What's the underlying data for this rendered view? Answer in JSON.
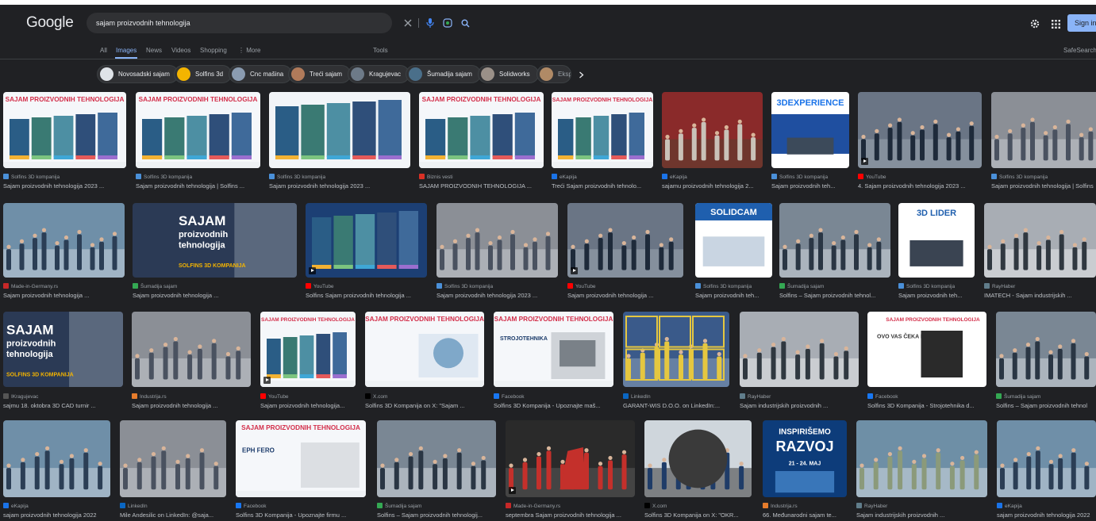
{
  "header": {
    "logo": "Google",
    "search_value": "sajam proizvodnih tehnologija",
    "signin_label": "Sign in"
  },
  "nav": {
    "tabs": [
      "All",
      "Images",
      "News",
      "Videos",
      "Shopping",
      "⋮ More"
    ],
    "tools": "Tools",
    "safesearch": "SafeSearch"
  },
  "chips": [
    "Novosadski sajam",
    "Solfins 3d",
    "Cnc mašina",
    "Treći sajam",
    "Kragujevac",
    "Šumadija sajam",
    "Solidworks",
    "Ekspo"
  ],
  "overlays": {
    "spt": "SAJAM PROIZVODNIH TEHNOLOGIJA",
    "sajam": "SAJAM",
    "proizvodnih": "proizvodnih",
    "tehnologija": "tehnologija",
    "solfins": "SOLFINS 3D KOMPANIJA",
    "exp": "3DEXPERIENCE",
    "solidcam": "SOLIDCAM",
    "lider": "3D LIDER",
    "inspirisemo": "INSPIRIŠEMO",
    "razvoj": "RAZVOJ",
    "maj": "21 - 24. MAJ",
    "ovo": "OVO VAS ČEKA NA SAJMU!",
    "eph": "EPH FERO",
    "strojotehnika": "STROJOTEHNIKA"
  },
  "results": [
    [
      {
        "source": "Solfins 3D kompanija",
        "title": "Sajam proizvodnih tehnologija 2023 ..."
      },
      {
        "source": "Solfins 3D kompanija",
        "title": "Sajam proizvodnih tehnologija | Solfins ..."
      },
      {
        "source": "Solfins 3D kompanija",
        "title": "Sajam proizvodnih tehnologija 2023 ..."
      },
      {
        "source": "Biznis vesti",
        "title": "SAJAM PROIZVODNIH TEHNOLOGIJA ..."
      },
      {
        "source": "eKapija",
        "title": "Treći Sajam proizvodnih tehnolo..."
      },
      {
        "source": "eKapija",
        "title": "sajamu proizvodnih tehnologija 2..."
      },
      {
        "source": "Solfins 3D kompanija",
        "title": "Sajam proizvodnih teh..."
      },
      {
        "source": "YouTube",
        "title": "4. Sajam proizvodnih tehnologija 2023 ..."
      },
      {
        "source": "Solfins 3D kompanija",
        "title": "Sajam proizvodnih tehnologija | Solfins"
      }
    ],
    [
      {
        "source": "Made-in-Germany.rs",
        "title": "Sajam proizvodnih tehnologija ..."
      },
      {
        "source": "Šumadija sajam",
        "title": "Sajam proizvodnih tehnologija ..."
      },
      {
        "source": "YouTube",
        "title": "Solfins Sajam proizvodnih tehnologija ..."
      },
      {
        "source": "Solfins 3D kompanija",
        "title": "Sajam proizvodnih tehnologija 2023 ..."
      },
      {
        "source": "YouTube",
        "title": "Sajam proizvodnih tehnologija ..."
      },
      {
        "source": "Solfins 3D kompanija",
        "title": "Sajam proizvodnih teh..."
      },
      {
        "source": "Šumadija sajam",
        "title": "Solfins – Sajam proizvodnih tehnol..."
      },
      {
        "source": "Solfins 3D kompanija",
        "title": "Sajam proizvodnih teh..."
      },
      {
        "source": "RayHaber",
        "title": "IMATECH - Sajam industrijskih ..."
      }
    ],
    [
      {
        "source": "IKragujevac",
        "title": "sajmu 18. oktobra 3D CAD turnir ..."
      },
      {
        "source": "Industrija.rs",
        "title": "Sajam proizvodnih tehnologija ..."
      },
      {
        "source": "YouTube",
        "title": "Sajam proizvodnih tehnologija..."
      },
      {
        "source": "X.com",
        "title": "Solfins 3D Kompanija on X: \"Sajam ..."
      },
      {
        "source": "Facebook",
        "title": "Solfins 3D Kompanija - Upoznajte maš..."
      },
      {
        "source": "LinkedIn",
        "title": "GARANT-WIS D.O.O. on LinkedIn:..."
      },
      {
        "source": "RayHaber",
        "title": "Sajam industrijskih proizvodnih ..."
      },
      {
        "source": "Facebook",
        "title": "Solfins 3D Kompanija - Strojotehnika d..."
      },
      {
        "source": "Šumadija sajam",
        "title": "Solfins – Sajam proizvodnih tehnol"
      }
    ],
    [
      {
        "source": "eKapija",
        "title": "sajam proizvodnih tehnologija 2022"
      },
      {
        "source": "LinkedIn",
        "title": "Mile Andesilic on LinkedIn: @saja..."
      },
      {
        "source": "Facebook",
        "title": "Solfins 3D Kompanija - Upoznajte firmu ..."
      },
      {
        "source": "Šumadija sajam",
        "title": "Solfins – Sajam proizvodnih tehnologij..."
      },
      {
        "source": "Made-in-Germany.rs",
        "title": "septembra Sajam proizvodnih tehnologija ..."
      },
      {
        "source": "X.com",
        "title": "Solfins 3D Kompanija on X: \"OKR..."
      },
      {
        "source": "Industrija.rs",
        "title": "66. Međunarodni sajam te..."
      },
      {
        "source": "RayHaber",
        "title": "Sajam industrijskih proizvodnih ..."
      },
      {
        "source": "eKapija",
        "title": "sajam proizvodnih tehnologija 2022"
      }
    ]
  ],
  "colors": {
    "background": "#202124",
    "link": "#8ab4f8",
    "text": "#bdc1c6",
    "muted": "#9aa0a6"
  }
}
